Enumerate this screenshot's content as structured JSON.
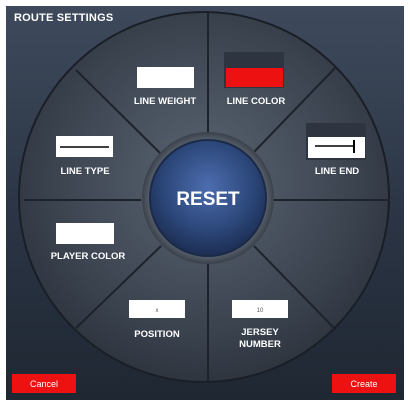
{
  "title": "ROUTE SETTINGS",
  "reset_label": "RESET",
  "segments": {
    "line_weight": {
      "label": "LINE WEIGHT",
      "swatch_color": "#ffffff"
    },
    "line_color": {
      "label": "LINE COLOR",
      "swatch_color": "#ee1111"
    },
    "line_end": {
      "label": "LINE END",
      "icon": "line-end-icon"
    },
    "line_type": {
      "label": "LINE TYPE",
      "icon": "line-type-icon"
    },
    "player_color": {
      "label": "PLAYER COLOR",
      "swatch_color": "#ffffff"
    },
    "position": {
      "label": "POSITION",
      "value": "x"
    },
    "jersey_number": {
      "label_line1": "JERSEY",
      "label_line2": "NUMBER",
      "value": "10"
    }
  },
  "buttons": {
    "cancel": "Cancel",
    "create": "Create"
  },
  "colors": {
    "accent": "#ee1111",
    "panel": "#2a3444",
    "reset_ring": "#33486e"
  }
}
